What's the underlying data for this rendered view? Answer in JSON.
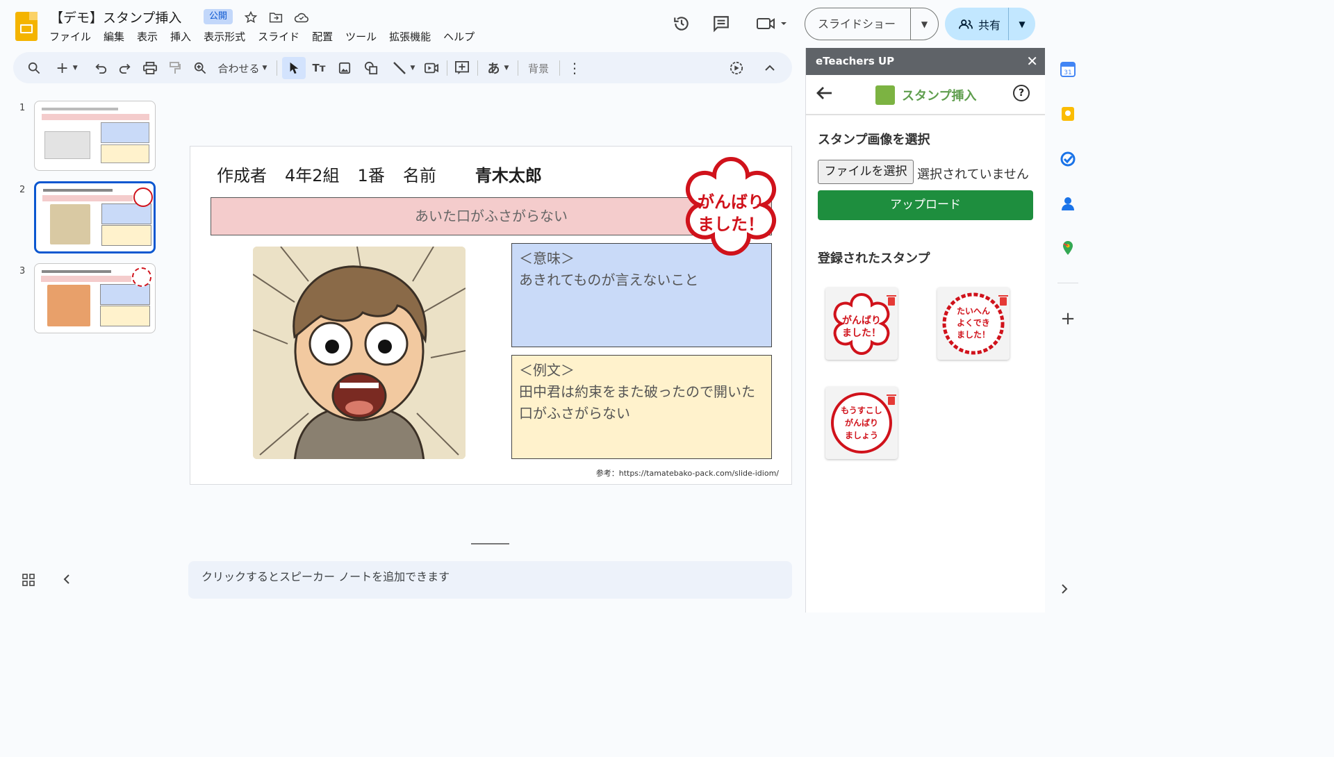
{
  "app": {
    "doc_title": "【デモ】スタンプ挿入",
    "badge": "公開",
    "menu": [
      "ファイル",
      "編集",
      "表示",
      "挿入",
      "表示形式",
      "スライド",
      "配置",
      "ツール",
      "拡張機能",
      "ヘルプ"
    ],
    "slideshow_label": "スライドショー",
    "share_label": "共有"
  },
  "toolbar": {
    "zoom_label": "合わせる",
    "bg_label": "背景",
    "font_icon_label": "あ"
  },
  "filmstrip": {
    "numbers": [
      "1",
      "2",
      "3"
    ],
    "selected_index": 2
  },
  "slide": {
    "header_parts": [
      "作成者",
      "4年2組",
      "1番",
      "名前"
    ],
    "student_name": "青木太郎",
    "idiom": "あいた口がふさがらない",
    "meaning_heading": "＜意味＞",
    "meaning_text": "あきれてものが言えないこと",
    "example_heading": "＜例文＞",
    "example_text": "田中君は約束をまた破ったので開いた口がふさがらない",
    "reference": "参考：https://tamatebako-pack.com/slide-idiom/",
    "stamp_text": [
      "がんばり",
      "ました！"
    ]
  },
  "notes": {
    "placeholder": "クリックするとスピーカー ノートを追加できます"
  },
  "panel": {
    "header": "eTeachers UP",
    "close": "✕",
    "title": "スタンプ挿入",
    "help": "?",
    "select_heading": "スタンプ画像を選択",
    "file_button": "ファイルを選択",
    "file_status": "選択されていません",
    "upload_button": "アップロード",
    "registered_heading": "登録されたスタンプ",
    "stamps": [
      {
        "lines": [
          "がんばり",
          "ました！"
        ]
      },
      {
        "lines": [
          "たいへん",
          "よくでき",
          "ました！"
        ]
      },
      {
        "lines": [
          "もうすこし",
          "がんばり",
          "ましょう"
        ]
      }
    ]
  },
  "colors": {
    "accent": "#0b57d0",
    "stamp_red": "#d0121b",
    "upload_green": "#1e8e3e",
    "title_pink": "#f4cccc",
    "meaning_blue": "#c9daf8",
    "example_yellow": "#fff2cc"
  }
}
